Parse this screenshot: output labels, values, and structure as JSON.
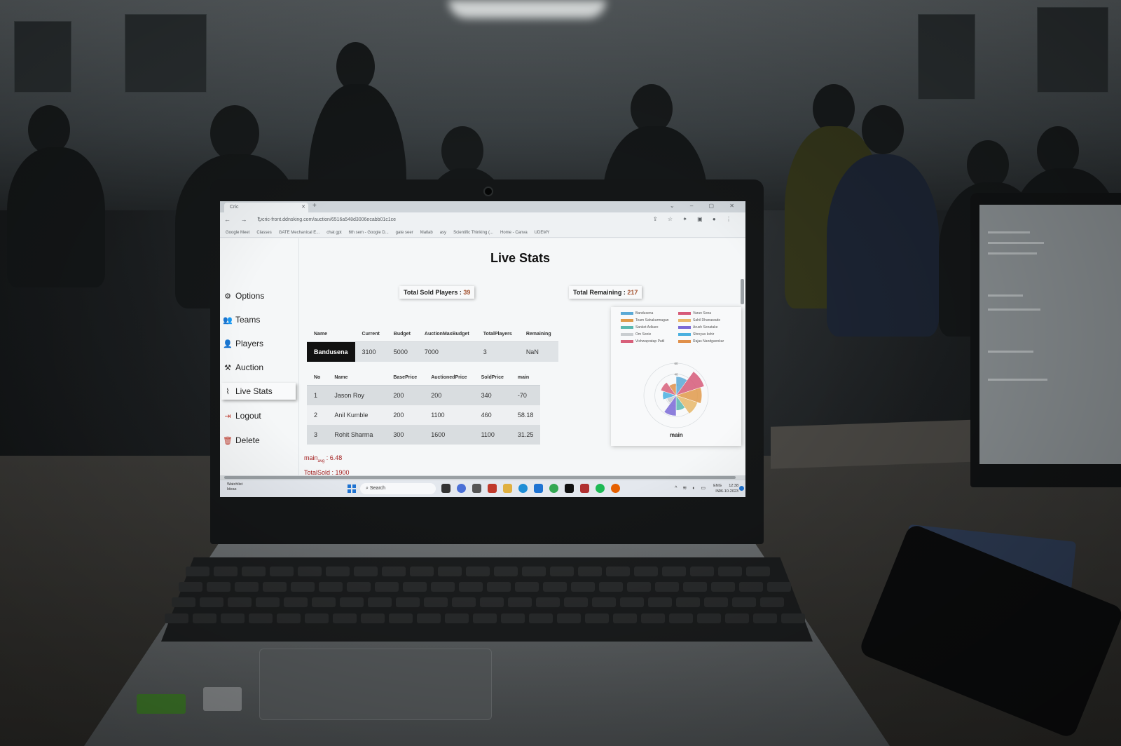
{
  "browser": {
    "tab_title": "Cric",
    "url": "cric-front.ddnsking.com/auction/6516a548d3006ecabb01c1ce",
    "bookmarks": [
      "Google Meet",
      "Classes",
      "GATE Mechanical E...",
      "chat gpt",
      "6th sem - Google D...",
      "gate seer",
      "Matlab",
      "asy",
      "Scientific Thinking (...",
      "Home - Canva",
      "UDEMY"
    ]
  },
  "sidebar": {
    "items": [
      {
        "label": "Options",
        "icon": "gear-icon"
      },
      {
        "label": "Teams",
        "icon": "users-icon"
      },
      {
        "label": "Players",
        "icon": "user-edit-icon"
      },
      {
        "label": "Auction",
        "icon": "gavel-icon"
      },
      {
        "label": "Live Stats",
        "icon": "chart-line-icon"
      },
      {
        "label": "Logout",
        "icon": "logout-icon"
      },
      {
        "label": "Delete",
        "icon": "trash-icon"
      }
    ]
  },
  "main": {
    "title": "Live Stats",
    "total_sold_label": "Total Sold Players : ",
    "total_sold_value": "39",
    "total_remaining_label": "Total Remaining : ",
    "total_remaining_value": "217",
    "team_table": {
      "headers": [
        "Name",
        "Current",
        "Budget",
        "AuctionMaxBudget",
        "TotalPlayers",
        "Remaining"
      ],
      "rows": [
        [
          "Bandusena",
          "3100",
          "5000",
          "7000",
          "3",
          "NaN"
        ]
      ]
    },
    "players_table": {
      "headers": [
        "No",
        "Name",
        "BasePrice",
        "AuctionedPrice",
        "SoldPrice",
        "main"
      ],
      "rows": [
        [
          "1",
          "Jason Roy",
          "200",
          "200",
          "340",
          "-70"
        ],
        [
          "2",
          "Anil Kumble",
          "200",
          "1100",
          "460",
          "58.18"
        ],
        [
          "3",
          "Rohit Sharma",
          "300",
          "1600",
          "1100",
          "31.25"
        ]
      ]
    },
    "summary": {
      "main_label": "main",
      "main_sub": "avg",
      "main_value": " : 6.48",
      "total_sold": "TotalSold : 1900"
    }
  },
  "chart_data": {
    "type": "pie",
    "subtype": "polar-area",
    "caption": "main",
    "legend": [
      {
        "name": "Bandusena",
        "color": "#5aa9d6"
      },
      {
        "name": "Varun Sona",
        "color": "#d65a78"
      },
      {
        "name": "Team Sahakarmagan",
        "color": "#e09a4a"
      },
      {
        "name": "Sahil Dhanawade",
        "color": "#e8b86a"
      },
      {
        "name": "Sanket Adkare",
        "color": "#5ab8b0"
      },
      {
        "name": "Arush Sonatake",
        "color": "#7a6ad6"
      },
      {
        "name": "Om Sonie",
        "color": "#c9cdd0"
      },
      {
        "name": "Shreyas kshir",
        "color": "#4ab0e0"
      },
      {
        "name": "Vishwapratap Patil",
        "color": "#d8607a"
      },
      {
        "name": "Rajas Nandgaonkar",
        "color": "#e0904a"
      }
    ],
    "radial_ticks": [
      "60",
      "40",
      "20"
    ],
    "values": [
      35,
      55,
      48,
      42,
      28,
      38,
      18,
      25,
      30,
      22
    ]
  },
  "taskbar": {
    "watchlist_title": "Watchlist",
    "watchlist_sub": "Ideas",
    "search_label": "Search",
    "lang_top": "ENG",
    "lang_bottom": "IN",
    "time": "12:38",
    "date": "06-10-2023"
  }
}
